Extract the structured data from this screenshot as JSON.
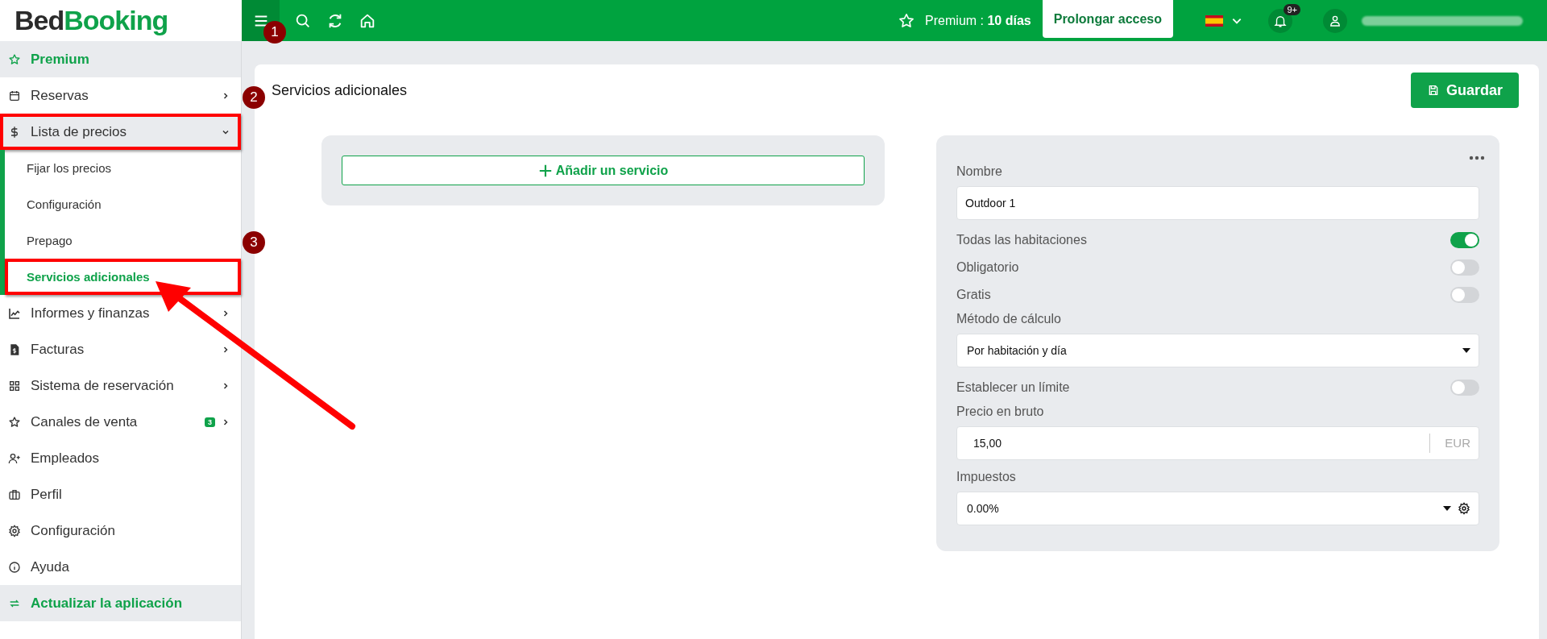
{
  "logo": {
    "dark_part": "Bed",
    "accent_part": "Booking"
  },
  "topbar": {
    "menu_annotation": "1",
    "premium": "Premium : **10 días**",
    "extend_button": "Prolongar acceso",
    "notifications_badge": "9+"
  },
  "sidebar": {
    "items": [
      {
        "label": "Premium",
        "kind": "promo"
      },
      {
        "label": "Reservas",
        "kind": "item",
        "expanded": false
      },
      {
        "label": "Lista de precios",
        "kind": "item",
        "expanded": true,
        "highlighted": true,
        "annotation": "2",
        "children": [
          {
            "label": "Fijar los precios",
            "selected": false,
            "highlighted": false
          },
          {
            "label": "Configuración",
            "selected": false,
            "highlighted": false
          },
          {
            "label": "Prepago",
            "selected": false,
            "highlighted": false
          },
          {
            "label": "Servicios adicionales",
            "selected": true,
            "highlighted": true,
            "annotation": "3"
          }
        ]
      },
      {
        "label": "Informes y finanzas",
        "kind": "item",
        "expanded": false
      },
      {
        "label": "Facturas",
        "kind": "item",
        "expanded": false
      },
      {
        "label": "Sistema de reservación",
        "kind": "item",
        "expanded": false
      },
      {
        "label": "Canales de venta",
        "kind": "item",
        "expanded": false,
        "badge": "3"
      },
      {
        "label": "Empleados",
        "kind": "item"
      },
      {
        "label": "Perfil",
        "kind": "item"
      },
      {
        "label": "Configuración",
        "kind": "item"
      },
      {
        "label": "Ayuda",
        "kind": "item"
      },
      {
        "label": "Actualizar la aplicación",
        "kind": "promo"
      }
    ]
  },
  "page": {
    "title": "Servicios adicionales",
    "save_button": "Guardar",
    "add_button": "Añadir un servicio"
  },
  "form": {
    "fields": [
      {
        "kind": "text",
        "label": "Nombre",
        "value": "Outdoor 1"
      },
      {
        "kind": "toggle",
        "label": "Todas las habitaciones",
        "on": true
      },
      {
        "kind": "toggle",
        "label": "Obligatorio",
        "on": false
      },
      {
        "kind": "toggle",
        "label": "Gratis",
        "on": false
      },
      {
        "kind": "select",
        "label": "Método de cálculo",
        "value": "Por habitación y día"
      },
      {
        "kind": "toggle",
        "label": "Establecer un límite",
        "on": false
      },
      {
        "kind": "money",
        "label": "Precio en bruto",
        "value": "15,00",
        "unit": "EUR"
      },
      {
        "kind": "select_settings",
        "label": "Impuestos",
        "value": "0.00%"
      }
    ]
  }
}
